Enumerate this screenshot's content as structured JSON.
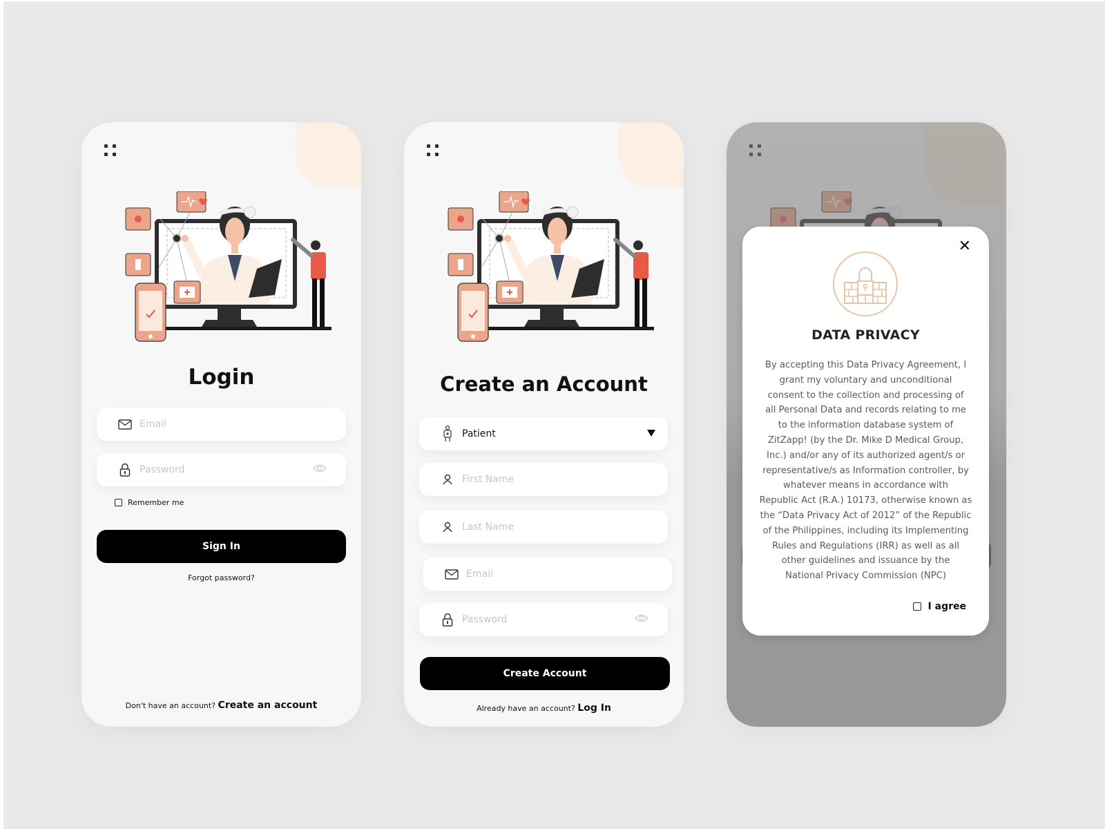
{
  "colors": {
    "background": "#e9e9e9",
    "phone_bg": "#f7f7f7",
    "accent_peach": "#fcefe3",
    "illustration_salmon": "#eaa58a",
    "illustration_red": "#e85a45",
    "primary_button": "#000000",
    "placeholder": "#c6c6c6",
    "privacy_emblem": "#e9c3a5"
  },
  "login": {
    "menu_icon": "grid-dots-icon",
    "title": "Login",
    "email_placeholder": "Email",
    "password_placeholder": "Password",
    "remember_label": "Remember me",
    "signin_label": "Sign In",
    "forgot_label": "Forgot password?",
    "footer_prompt": "Don't have an account?",
    "footer_link": "Create an account"
  },
  "register": {
    "menu_icon": "grid-dots-icon",
    "title": "Create an Account",
    "role_value": "Patient",
    "first_name_placeholder": "First Name",
    "last_name_placeholder": "Last Name",
    "email_placeholder": "Email",
    "password_placeholder": "Password",
    "submit_label": "Create Account",
    "footer_prompt": "Already have an account?",
    "footer_link": "Log In"
  },
  "privacy": {
    "close_icon": "close-icon",
    "emblem_icon": "lock-wall-icon",
    "heading": "DATA PRIVACY",
    "body_lines": [
      "By accepting this Data Privacy Agreement, I",
      "grant my voluntary and unconditional",
      "consent to the collection and processing of",
      "all Personal Data and records relating to me",
      "to the information database system of",
      "ZitZapp! (by the Dr. Mike D Medical Group,",
      "Inc.) and/or any of its authorized agent/s or",
      "representative/s as Information controller, by",
      "whatever means in accordance with",
      "Republic Act (R.A.) 10173, otherwise known as",
      "the “Data Privacy Act of 2012” of the Republic",
      "of the Philippines, including its Implementing",
      "Rules and Regulations (IRR) as well as all",
      "other guidelines and issuance by the",
      "National Privacy Commission (NPC)"
    ],
    "agree_label": "I agree"
  }
}
